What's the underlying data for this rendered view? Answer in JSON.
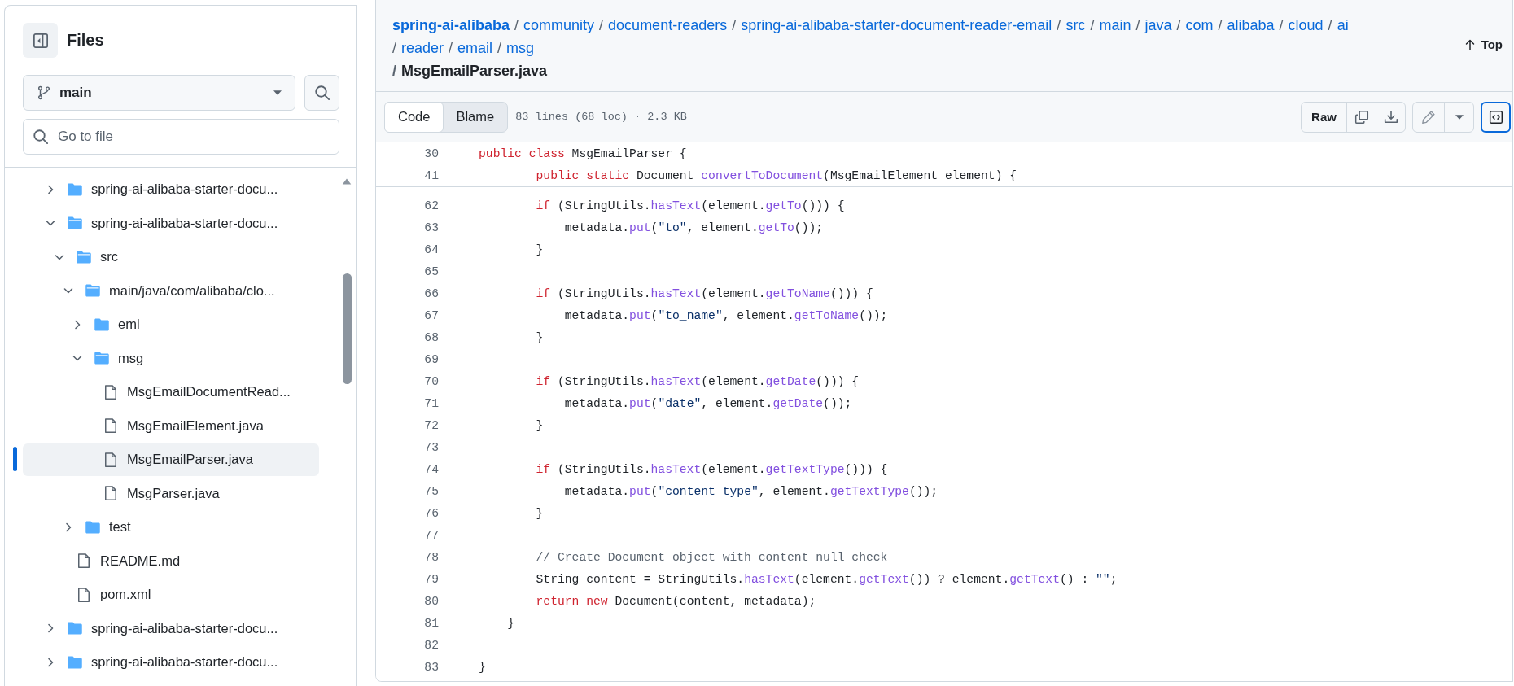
{
  "sidebar": {
    "title": "Files",
    "branch": "main",
    "search": {
      "placeholder": "Go to file"
    },
    "tree": [
      {
        "name": "spring-ai-alibaba-starter-docu...",
        "kind": "folder",
        "expanded": false,
        "selected": false
      },
      {
        "name": "spring-ai-alibaba-starter-docu...",
        "kind": "folder",
        "expanded": true,
        "selected": false,
        "children": [
          {
            "name": "src",
            "kind": "folder",
            "expanded": true,
            "selected": false,
            "children": [
              {
                "name": "main/java/com/alibaba/clo...",
                "kind": "folder",
                "expanded": true,
                "selected": false,
                "children": [
                  {
                    "name": "eml",
                    "kind": "folder",
                    "expanded": false,
                    "selected": false
                  },
                  {
                    "name": "msg",
                    "kind": "folder",
                    "expanded": true,
                    "selected": false,
                    "children": [
                      {
                        "name": "MsgEmailDocumentRead...",
                        "kind": "file",
                        "selected": false
                      },
                      {
                        "name": "MsgEmailElement.java",
                        "kind": "file",
                        "selected": false
                      },
                      {
                        "name": "MsgEmailParser.java",
                        "kind": "file",
                        "selected": true
                      },
                      {
                        "name": "MsgParser.java",
                        "kind": "file",
                        "selected": false
                      }
                    ]
                  }
                ]
              },
              {
                "name": "test",
                "kind": "folder",
                "expanded": false,
                "selected": false
              }
            ]
          },
          {
            "name": "README.md",
            "kind": "file",
            "selected": false
          },
          {
            "name": "pom.xml",
            "kind": "file",
            "selected": false
          }
        ]
      },
      {
        "name": "spring-ai-alibaba-starter-docu...",
        "kind": "folder",
        "expanded": false,
        "selected": false
      },
      {
        "name": "spring-ai-alibaba-starter-docu...",
        "kind": "folder",
        "expanded": false,
        "selected": false
      }
    ]
  },
  "breadcrumb": {
    "segments": [
      {
        "label": "spring-ai-alibaba",
        "kind": "root"
      },
      {
        "separator": "/",
        "label": "community",
        "kind": "link"
      },
      {
        "separator": "/",
        "label": "document-readers",
        "kind": "link"
      },
      {
        "separator": "/",
        "label": "spring-ai-alibaba-starter-document-reader-email",
        "kind": "link"
      },
      {
        "separator": "/",
        "label": "src",
        "kind": "link"
      },
      {
        "separator": "/",
        "label": "main",
        "kind": "link"
      },
      {
        "separator": "/",
        "label": "java",
        "kind": "link"
      },
      {
        "separator": "/",
        "label": "com",
        "kind": "link"
      },
      {
        "separator": "/",
        "label": "alibaba",
        "kind": "link"
      },
      {
        "separator": "/",
        "label": "cloud",
        "kind": "link"
      },
      {
        "separator": "/",
        "label": "ai",
        "kind": "link"
      },
      {
        "separator": "/",
        "label": "reader",
        "kind": "link"
      },
      {
        "separator": "/",
        "label": "email",
        "kind": "link"
      },
      {
        "separator": "/",
        "label": "msg",
        "kind": "link"
      },
      {
        "separator": "/",
        "label": "MsgEmailParser.java",
        "kind": "current"
      }
    ]
  },
  "top_link": "Top",
  "tabs": [
    {
      "label": "Code",
      "selected": true
    },
    {
      "label": "Blame",
      "selected": false
    }
  ],
  "file_info": "83 lines (68 loc) · 2.3 KB",
  "raw_button": "Raw",
  "symbols_open": true,
  "sticky_lines": [
    {
      "number": "30",
      "tokens": [
        {
          "kind": "keyword",
          "text": "public"
        },
        {
          "kind": "keyword",
          "text": " class"
        },
        {
          "kind": "plain",
          "text": " MsgEmailParser {"
        }
      ]
    },
    {
      "number": "41",
      "tokens": [
        {
          "kind": "keyword",
          "text": "        public"
        },
        {
          "kind": "keyword",
          "text": " static"
        },
        {
          "kind": "plain",
          "text": " Document "
        },
        {
          "kind": "function",
          "text": "convertToDocument"
        },
        {
          "kind": "plain",
          "text": "(MsgEmailElement element) {"
        }
      ]
    }
  ],
  "lines": [
    {
      "number": "62",
      "tokens": [
        {
          "kind": "keyword",
          "text": "        if"
        },
        {
          "kind": "plain",
          "text": " (StringUtils."
        },
        {
          "kind": "function",
          "text": "hasText"
        },
        {
          "kind": "plain",
          "text": "(element."
        },
        {
          "kind": "function",
          "text": "getTo"
        },
        {
          "kind": "plain",
          "text": "())) {"
        }
      ]
    },
    {
      "number": "63",
      "tokens": [
        {
          "kind": "plain",
          "text": "            metadata."
        },
        {
          "kind": "function",
          "text": "put"
        },
        {
          "kind": "plain",
          "text": "("
        },
        {
          "kind": "string",
          "text": "\"to\""
        },
        {
          "kind": "plain",
          "text": ", element."
        },
        {
          "kind": "function",
          "text": "getTo"
        },
        {
          "kind": "plain",
          "text": "());"
        }
      ]
    },
    {
      "number": "64",
      "tokens": [
        {
          "kind": "plain",
          "text": "        }"
        }
      ]
    },
    {
      "number": "65"
    },
    {
      "number": "66",
      "tokens": [
        {
          "kind": "keyword",
          "text": "        if"
        },
        {
          "kind": "plain",
          "text": " (StringUtils."
        },
        {
          "kind": "function",
          "text": "hasText"
        },
        {
          "kind": "plain",
          "text": "(element."
        },
        {
          "kind": "function",
          "text": "getToName"
        },
        {
          "kind": "plain",
          "text": "())) {"
        }
      ]
    },
    {
      "number": "67",
      "tokens": [
        {
          "kind": "plain",
          "text": "            metadata."
        },
        {
          "kind": "function",
          "text": "put"
        },
        {
          "kind": "plain",
          "text": "("
        },
        {
          "kind": "string",
          "text": "\"to_name\""
        },
        {
          "kind": "plain",
          "text": ", element."
        },
        {
          "kind": "function",
          "text": "getToName"
        },
        {
          "kind": "plain",
          "text": "());"
        }
      ]
    },
    {
      "number": "68",
      "tokens": [
        {
          "kind": "plain",
          "text": "        }"
        }
      ]
    },
    {
      "number": "69"
    },
    {
      "number": "70",
      "tokens": [
        {
          "kind": "keyword",
          "text": "        if"
        },
        {
          "kind": "plain",
          "text": " (StringUtils."
        },
        {
          "kind": "function",
          "text": "hasText"
        },
        {
          "kind": "plain",
          "text": "(element."
        },
        {
          "kind": "function",
          "text": "getDate"
        },
        {
          "kind": "plain",
          "text": "())) {"
        }
      ]
    },
    {
      "number": "71",
      "tokens": [
        {
          "kind": "plain",
          "text": "            metadata."
        },
        {
          "kind": "function",
          "text": "put"
        },
        {
          "kind": "plain",
          "text": "("
        },
        {
          "kind": "string",
          "text": "\"date\""
        },
        {
          "kind": "plain",
          "text": ", element."
        },
        {
          "kind": "function",
          "text": "getDate"
        },
        {
          "kind": "plain",
          "text": "());"
        }
      ]
    },
    {
      "number": "72",
      "tokens": [
        {
          "kind": "plain",
          "text": "        }"
        }
      ]
    },
    {
      "number": "73"
    },
    {
      "number": "74",
      "tokens": [
        {
          "kind": "keyword",
          "text": "        if"
        },
        {
          "kind": "plain",
          "text": " (StringUtils."
        },
        {
          "kind": "function",
          "text": "hasText"
        },
        {
          "kind": "plain",
          "text": "(element."
        },
        {
          "kind": "function",
          "text": "getTextType"
        },
        {
          "kind": "plain",
          "text": "())) {"
        }
      ]
    },
    {
      "number": "75",
      "tokens": [
        {
          "kind": "plain",
          "text": "            metadata."
        },
        {
          "kind": "function",
          "text": "put"
        },
        {
          "kind": "plain",
          "text": "("
        },
        {
          "kind": "string",
          "text": "\"content_type\""
        },
        {
          "kind": "plain",
          "text": ", element."
        },
        {
          "kind": "function",
          "text": "getTextType"
        },
        {
          "kind": "plain",
          "text": "());"
        }
      ]
    },
    {
      "number": "76",
      "tokens": [
        {
          "kind": "plain",
          "text": "        }"
        }
      ]
    },
    {
      "number": "77"
    },
    {
      "number": "78",
      "tokens": [
        {
          "kind": "comment",
          "text": "        // Create Document object with content null check"
        }
      ]
    },
    {
      "number": "79",
      "tokens": [
        {
          "kind": "plain",
          "text": "        String content = StringUtils."
        },
        {
          "kind": "function",
          "text": "hasText"
        },
        {
          "kind": "plain",
          "text": "(element."
        },
        {
          "kind": "function",
          "text": "getText"
        },
        {
          "kind": "plain",
          "text": "()) ? element."
        },
        {
          "kind": "function",
          "text": "getText"
        },
        {
          "kind": "plain",
          "text": "() : "
        },
        {
          "kind": "string",
          "text": "\"\""
        },
        {
          "kind": "plain",
          "text": ";"
        }
      ]
    },
    {
      "number": "80",
      "tokens": [
        {
          "kind": "keyword",
          "text": "        return"
        },
        {
          "kind": "keyword",
          "text": " new"
        },
        {
          "kind": "plain",
          "text": " Document(content, metadata);"
        }
      ]
    },
    {
      "number": "81",
      "tokens": [
        {
          "kind": "plain",
          "text": "    }"
        }
      ]
    },
    {
      "number": "82"
    },
    {
      "number": "83",
      "tokens": [
        {
          "kind": "plain",
          "text": "}"
        }
      ]
    }
  ]
}
